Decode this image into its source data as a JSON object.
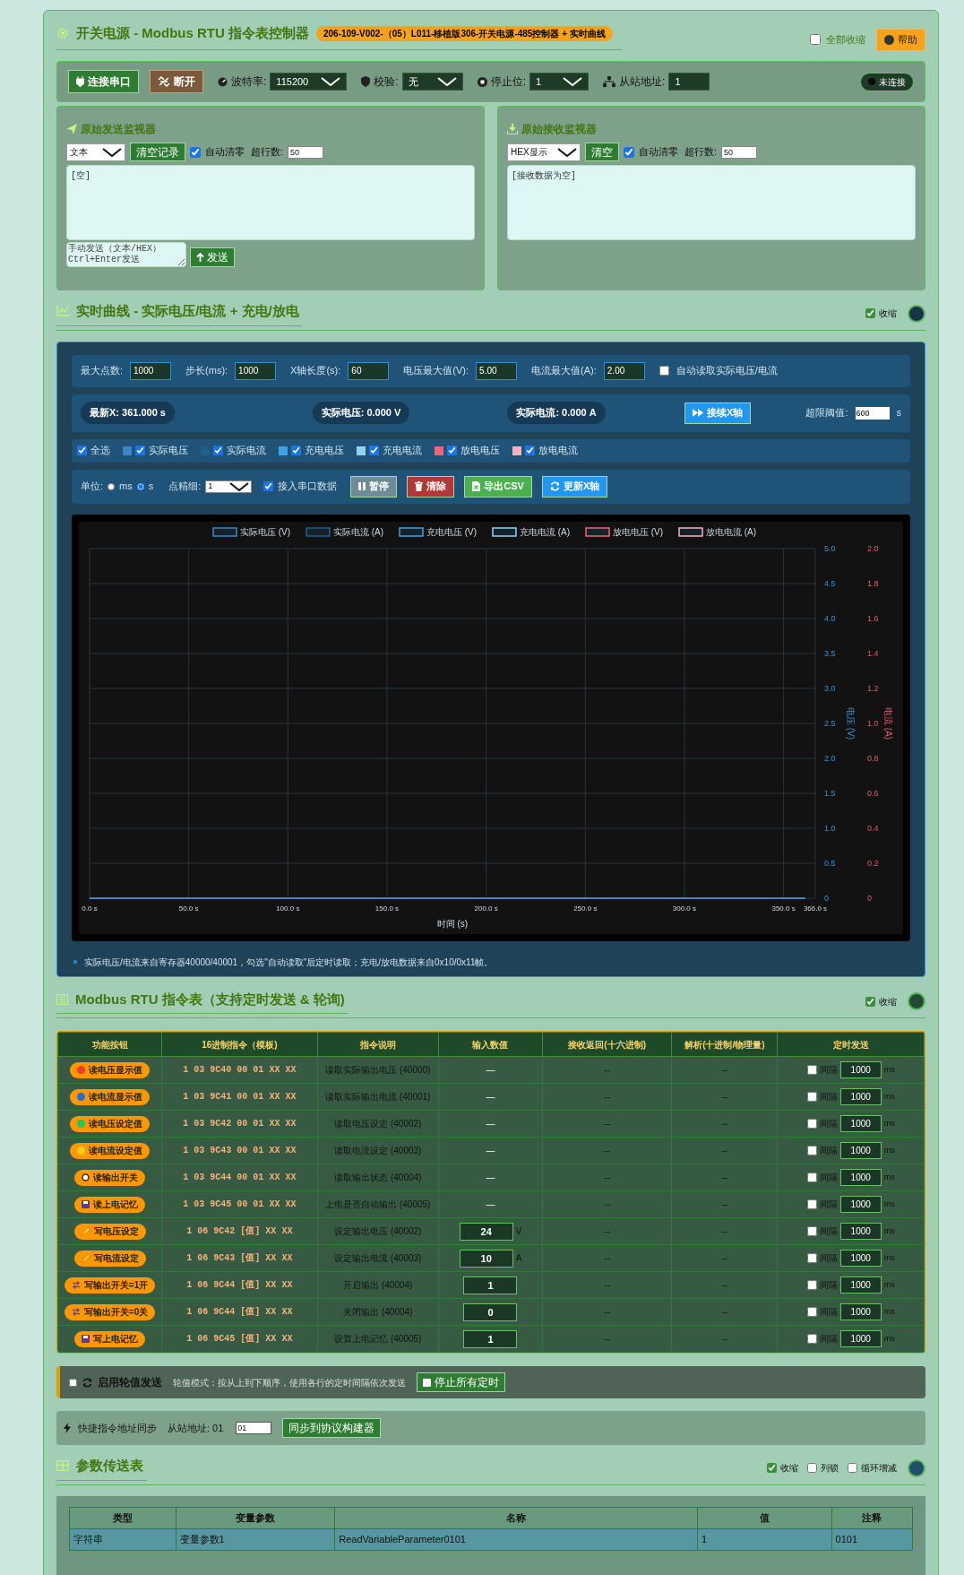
{
  "header": {
    "title": "开关电源 - Modbus RTU 指令表控制器",
    "badge": "206-109-V002-（05）L011-移植版306-开关电源-485控制器 + 实时曲线",
    "collapse_all": {
      "label": "全部收缩",
      "checked": false
    },
    "help": "帮助"
  },
  "toolbar": {
    "connect": "连接串口",
    "disconnect": "断开",
    "fields": [
      {
        "kind": "baud",
        "label": "波特率:",
        "value": "115200"
      },
      {
        "kind": "parity",
        "label": "校验:",
        "value": "无"
      },
      {
        "kind": "stopbits",
        "label": "停止位:",
        "value": "1"
      },
      {
        "kind": "address",
        "label": "从站地址:",
        "value": "1"
      }
    ],
    "status": "未连接"
  },
  "send_monitor": {
    "title": "原始发送监视器",
    "format": "文本",
    "clear": "清空记录",
    "auto_clear": {
      "label": "自动清零",
      "checked": true
    },
    "limit_label": "超行数:",
    "limit": "50",
    "log": "[空]",
    "manual_placeholder": "手动发送（文本/HEX）\nCtrl+Enter发送",
    "send": "发送"
  },
  "receive_monitor": {
    "title": "原始接收监视器",
    "format": "HEX显示",
    "clear": "清空",
    "auto_clear": {
      "label": "自动清零",
      "checked": true
    },
    "limit_label": "超行数:",
    "limit": "50",
    "log": "[接收数据为空]"
  },
  "chart_section": {
    "title": "实时曲线 - 实际电压/电流 + 充电/放电",
    "collapse": {
      "label": "收缩",
      "checked": true
    },
    "settings": [
      {
        "label": "最大点数:",
        "value": "1000"
      },
      {
        "label": "步长(ms):",
        "value": "1000"
      },
      {
        "label": "X轴长度(s):",
        "value": "60"
      },
      {
        "label": "电压最大值(V):",
        "value": "5.00"
      },
      {
        "label": "电流最大值(A):",
        "value": "2.00"
      }
    ],
    "auto_read": {
      "label": "自动读取实际电压/电流",
      "checked": false
    },
    "readouts": [
      "最新X: 361.000 s",
      "实际电压: 0.000 V",
      "实际电流: 0.000 A"
    ],
    "follow_button": "接续X轴",
    "limit_label": "超限阈值:",
    "limit": "600",
    "limit_unit": "s",
    "series_toggles": [
      {
        "label": "全选",
        "checked": true
      },
      {
        "label": "实际电压",
        "checked": true,
        "color": "#3a86c8"
      },
      {
        "label": "实际电流",
        "checked": true,
        "color": "#1d5f8c"
      },
      {
        "label": "充电电压",
        "checked": true,
        "color": "#3fa2e6"
      },
      {
        "label": "充电电流",
        "checked": true,
        "color": "#8fd3f0"
      },
      {
        "label": "放电电压",
        "checked": true,
        "color": "#f06478"
      },
      {
        "label": "放电电流",
        "checked": true,
        "color": "#f7b4c0"
      }
    ],
    "unit_label": "单位:",
    "units": [
      {
        "label": "ms",
        "selected": false
      },
      {
        "label": "s",
        "selected": true
      }
    ],
    "precision_label": "点精细:",
    "precision": "1",
    "serial_input": {
      "label": "接入串口数据",
      "checked": true
    },
    "buttons": [
      {
        "kind": "pause",
        "label": "暂停"
      },
      {
        "kind": "clear",
        "label": "清除"
      },
      {
        "kind": "export",
        "label": "导出CSV"
      },
      {
        "kind": "refresh",
        "label": "更新X轴"
      }
    ],
    "chart_data": {
      "type": "line",
      "grid": true,
      "legend": true,
      "xlabel": "时间 (s)",
      "ylabel": "电压 (V)",
      "y2label": "电流 (A)",
      "x": [
        0,
        361
      ],
      "xlim": [
        0,
        366
      ],
      "xticks": [
        {
          "value": 0,
          "label": "0.0 s"
        },
        {
          "value": 50,
          "label": "50.0 s"
        },
        {
          "value": 100,
          "label": "100.0 s"
        },
        {
          "value": 150,
          "label": "150.0 s"
        },
        {
          "value": 200,
          "label": "200.0 s"
        },
        {
          "value": 250,
          "label": "250.0 s"
        },
        {
          "value": 300,
          "label": "300.0 s"
        },
        {
          "value": 350,
          "label": "350.0 s"
        },
        {
          "value": 366,
          "label": "366.0 s"
        }
      ],
      "ylim": [
        0,
        5
      ],
      "yticks": [
        {
          "value": 0,
          "label": "0"
        },
        {
          "value": 0.5,
          "label": "0.5"
        },
        {
          "value": 1,
          "label": "1.0"
        },
        {
          "value": 1.5,
          "label": "1.5"
        },
        {
          "value": 2,
          "label": "2.0"
        },
        {
          "value": 2.5,
          "label": "2.5"
        },
        {
          "value": 3,
          "label": "3.0"
        },
        {
          "value": 3.5,
          "label": "3.5"
        },
        {
          "value": 4,
          "label": "4.0"
        },
        {
          "value": 4.5,
          "label": "4.5"
        },
        {
          "value": 5,
          "label": "5.0"
        }
      ],
      "y2lim": [
        0,
        2
      ],
      "y2ticks": [
        {
          "value": 0,
          "label": "0"
        },
        {
          "value": 0.2,
          "label": "0.2"
        },
        {
          "value": 0.4,
          "label": "0.4"
        },
        {
          "value": 0.6,
          "label": "0.6"
        },
        {
          "value": 0.8,
          "label": "0.8"
        },
        {
          "value": 1,
          "label": "1.0"
        },
        {
          "value": 1.2,
          "label": "1.2"
        },
        {
          "value": 1.4,
          "label": "1.4"
        },
        {
          "value": 1.6,
          "label": "1.6"
        },
        {
          "value": 1.8,
          "label": "1.8"
        },
        {
          "value": 2,
          "label": "2.0"
        }
      ],
      "series": [
        {
          "name": "实际电压 (V)",
          "color": "#3a86c8",
          "values": [
            0,
            0
          ]
        },
        {
          "name": "实际电流 (A)",
          "color": "#1d5f8c",
          "values": [
            null,
            null
          ]
        },
        {
          "name": "充电电压 (V)",
          "color": "#3fa2e6",
          "values": [
            null,
            null
          ]
        },
        {
          "name": "充电电流 (A)",
          "color": "#8fd3f0",
          "values": [
            null,
            null
          ]
        },
        {
          "name": "放电电压 (V)",
          "color": "#f06478",
          "values": [
            null,
            null
          ]
        },
        {
          "name": "放电电流 (A)",
          "color": "#f7b4c0",
          "values": [
            null,
            null
          ]
        }
      ]
    },
    "note": "实际电压/电流来自寄存器40000/40001，勾选\"自动读取\"后定时读取；充电/放电数据来自0x10/0x11帧。"
  },
  "command_section": {
    "title": "Modbus RTU 指令表（支持定时发送 & 轮询)",
    "collapse": {
      "label": "收缩",
      "checked": true
    },
    "columns": [
      "功能按钮",
      "16进制指令（模板)",
      "指令说明",
      "输入数值",
      "接收返回(十六进制)",
      "解析(十进制/物理量)",
      "定时发送"
    ],
    "rows": [
      {
        "kind": "measure",
        "color": "#ef3b36",
        "button": "读电压显示值",
        "hex": "1 03 9C40 00 01 XX XX",
        "desc": "读取实际输出电压 (40000)",
        "input_text": "—",
        "received": "--",
        "parsed": "--",
        "timer": {
          "checked": false,
          "label": "间隔",
          "value": "1000",
          "unit": "ms"
        }
      },
      {
        "kind": "measure",
        "color": "#1e6fd9",
        "button": "读电流显示值",
        "hex": "1 03 9C41 00 01 XX XX",
        "desc": "读取实际输出电流 (40001)",
        "input_text": "—",
        "received": "--",
        "parsed": "--",
        "timer": {
          "checked": false,
          "label": "间隔",
          "value": "1000",
          "unit": "ms"
        }
      },
      {
        "kind": "measure",
        "color": "#22c55e",
        "button": "读电压设定值",
        "hex": "1 03 9C42 00 01 XX XX",
        "desc": "读取电压设定 (40002)",
        "input_text": "—",
        "received": "--",
        "parsed": "--",
        "timer": {
          "checked": false,
          "label": "间隔",
          "value": "1000",
          "unit": "ms"
        }
      },
      {
        "kind": "measure",
        "color": "#facc15",
        "button": "读电流设定值",
        "hex": "1 03 9C43 00 01 XX XX",
        "desc": "读取电流设定 (40003)",
        "input_text": "—",
        "received": "--",
        "parsed": "--",
        "timer": {
          "checked": false,
          "label": "间隔",
          "value": "1000",
          "unit": "ms"
        }
      },
      {
        "kind": "status",
        "button": "读输出开关",
        "hex": "1 03 9C44 00 01 XX XX",
        "desc": "读取输出状态 (40004)",
        "input_text": "—",
        "received": "--",
        "parsed": "--",
        "timer": {
          "checked": false,
          "label": "间隔",
          "value": "1000",
          "unit": "ms"
        }
      },
      {
        "kind": "memory",
        "button": "读上电记忆",
        "hex": "1 03 9C45 00 01 XX XX",
        "desc": "上电是否自动输出 (40005)",
        "input_text": "—",
        "received": "--",
        "parsed": "--",
        "timer": {
          "checked": false,
          "label": "间隔",
          "value": "1000",
          "unit": "ms"
        }
      },
      {
        "kind": "setpoint",
        "button": "写电压设定",
        "hex": "1 06 9C42 [值] XX XX",
        "desc": "设定输出电压 (40002)",
        "input_value": "24",
        "input_unit": "V",
        "received": "--",
        "parsed": "--",
        "timer": {
          "checked": false,
          "label": "间隔",
          "value": "1000",
          "unit": "ms"
        }
      },
      {
        "kind": "setpoint",
        "button": "写电流设定",
        "hex": "1 06 9C43 [值] XX XX",
        "desc": "设定输出电流 (40003)",
        "input_value": "10",
        "input_unit": "A",
        "received": "--",
        "parsed": "--",
        "timer": {
          "checked": false,
          "label": "间隔",
          "value": "1000",
          "unit": "ms"
        }
      },
      {
        "kind": "switch",
        "button": "写输出开关=1开",
        "hex": "1 06 9C44 [值] XX XX",
        "desc": "开启输出 (40004)",
        "input_value": "1",
        "received": "--",
        "parsed": "--",
        "timer": {
          "checked": false,
          "label": "间隔",
          "value": "1000",
          "unit": "ms"
        }
      },
      {
        "kind": "switch",
        "button": "写输出开关=0关",
        "hex": "1 06 9C44 [值] XX XX",
        "desc": "关闭输出 (40004)",
        "input_value": "0",
        "received": "--",
        "parsed": "--",
        "timer": {
          "checked": false,
          "label": "间隔",
          "value": "1000",
          "unit": "ms"
        }
      },
      {
        "kind": "memory",
        "button": "写上电记忆",
        "hex": "1 06 9C45 [值] XX XX",
        "desc": "设置上电记忆 (40005)",
        "input_value": "1",
        "received": "--",
        "parsed": "--",
        "timer": {
          "checked": false,
          "label": "间隔",
          "value": "1000",
          "unit": "ms"
        }
      }
    ]
  },
  "polling": {
    "enabled": {
      "label": "启用轮值发送",
      "checked": false
    },
    "hint": "轮值模式：按从上到下顺序，使用各行的定时间隔依次发送",
    "stop": "停止所有定时"
  },
  "quick_sync": {
    "title": "快捷指令地址同步",
    "label": "从站地址: 01",
    "value": "01",
    "button": "同步到协议构建器"
  },
  "params_section": {
    "title": "参数传送表",
    "options": [
      {
        "label": "收缩",
        "checked": true
      },
      {
        "label": "列锁",
        "checked": false
      },
      {
        "label": "循环增减",
        "checked": false
      }
    ],
    "columns": [
      "类型",
      "变量参数",
      "名称",
      "值",
      "注释"
    ],
    "rows": [
      [
        "字符串",
        "变量参数1",
        "ReadVariableParameter0101",
        "1",
        "0101"
      ]
    ]
  }
}
